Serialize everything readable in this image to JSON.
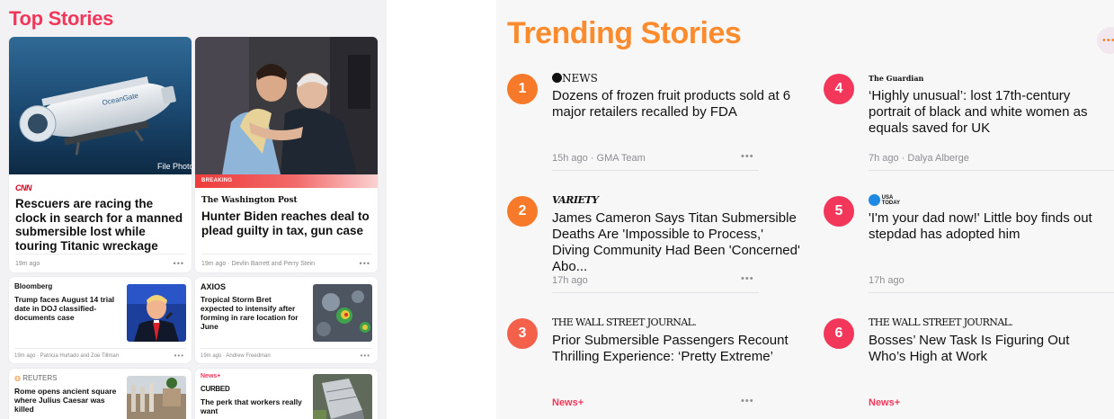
{
  "top_stories": {
    "title": "Top Stories",
    "hero_left": {
      "photo_caption": "File Photo",
      "source": "CNN",
      "headline": "Rescuers are racing the clock in search for a manned submersible lost while touring Titanic wreckage",
      "time": "19m ago",
      "more": "•••"
    },
    "hero_right": {
      "badge": "BREAKING",
      "source": "The Washington Post",
      "headline": "Hunter Biden reaches deal to plead guilty in tax, gun case",
      "meta": "19m ago · Devlin Barrett and Perry Stein",
      "more": "•••"
    },
    "small_cards": [
      {
        "source": "Bloomberg",
        "headline": "Trump faces August 14 trial date in DOJ classified-documents case",
        "meta": "19m ago · Patricia Hurtado and Zoe Tillman",
        "more": "•••"
      },
      {
        "source": "AXIOS",
        "headline": "Tropical Storm Bret expected to intensify after forming in rare location for June",
        "meta": "19m ago · Andrew Freedman",
        "more": "•••"
      },
      {
        "source": "REUTERS",
        "headline": "Rome opens ancient square where Julius Caesar was killed"
      },
      {
        "badge": "News+",
        "source": "CURBED",
        "headline": "The perk that workers really want"
      }
    ]
  },
  "trending": {
    "title": "Trending Stories",
    "more": "•••",
    "items": [
      {
        "rank": "1",
        "source": "NEWS",
        "headline": "Dozens of frozen fruit products sold at 6 major retailers recalled by FDA",
        "meta": "15h ago · GMA Team",
        "more": "•••",
        "color": "#f77a2a"
      },
      {
        "rank": "2",
        "source": "VARIETY",
        "headline": "James Cameron Says Titan Submersible Deaths Are 'Impossible to Process,' Diving Community Had Been 'Concerned' Abo...",
        "meta": "17h ago",
        "more": "•••",
        "color": "#f77a2a"
      },
      {
        "rank": "3",
        "source": "THE WALL STREET JOURNAL.",
        "headline": "Prior Submersible Passengers Recount Thrilling Experience: ‘Pretty Extreme’",
        "meta": "News+",
        "more": "•••",
        "color": "#f5604a"
      },
      {
        "rank": "4",
        "source": "The Guardian",
        "headline": "‘Highly unusual’: lost 17th-century portrait of black and white women as equals saved for UK",
        "meta": "7h ago · Dalya Alberge",
        "more": "•••",
        "color": "#f2375b"
      },
      {
        "rank": "5",
        "source": "USA TODAY",
        "headline": "'I'm your dad now!' Little boy finds out stepdad has adopted him",
        "meta": "17h ago",
        "more": "•••",
        "color": "#f2375b"
      },
      {
        "rank": "6",
        "source": "THE WALL STREET JOURNAL.",
        "headline": "Bosses’ New Task Is Figuring Out Who’s High at Work",
        "meta": "News+",
        "more": "•••",
        "color": "#f2375b"
      }
    ]
  }
}
